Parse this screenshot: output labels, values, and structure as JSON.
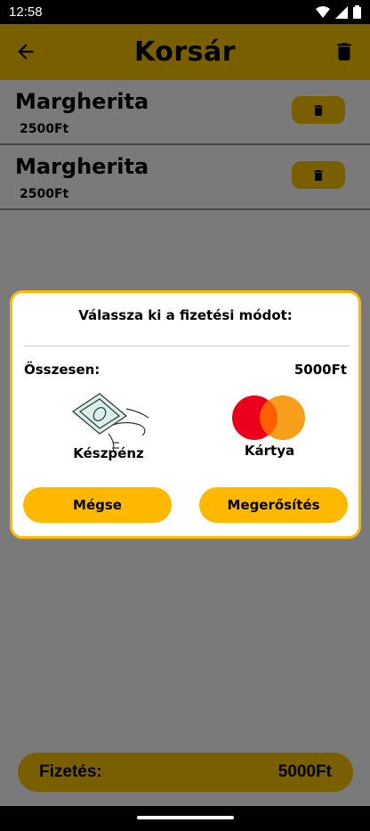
{
  "status_bar": {
    "time": "12:58"
  },
  "app_bar": {
    "title": "Korsár"
  },
  "cart": {
    "items": [
      {
        "name": "Margherita",
        "price": "2500Ft"
      },
      {
        "name": "Margherita",
        "price": "2500Ft"
      }
    ]
  },
  "dialog": {
    "title": "Válassza ki a fizetési módot:",
    "total_label": "Összesen:",
    "total_value": "5000Ft",
    "cash_label": "Készpénz",
    "card_label": "Kártya",
    "cancel_label": "Mégse",
    "confirm_label": "Megerősítés"
  },
  "footer": {
    "pay_label": "Fizetés:",
    "pay_total": "5000Ft"
  },
  "colors": {
    "accent": "#ffb800",
    "accent_dimmed": "#7a5f00",
    "scrim": "#7a7a7a",
    "mc_red": "#eb001b",
    "mc_orange": "#f79e1b",
    "mc_overlap": "#ff5f00"
  }
}
